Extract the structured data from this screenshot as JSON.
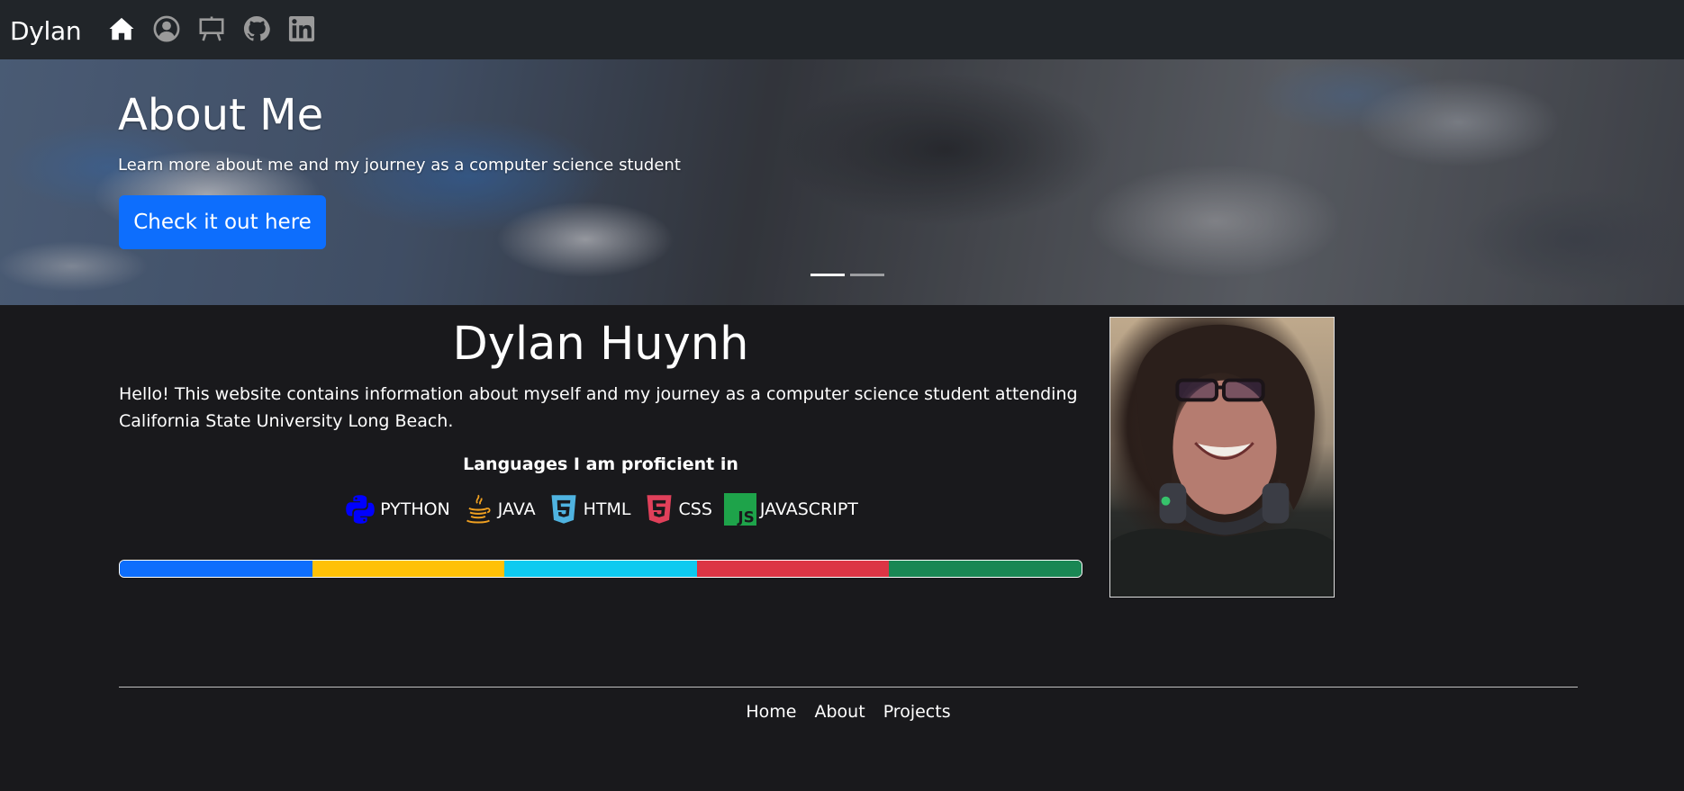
{
  "navbar": {
    "brand": "Dylan",
    "icons": [
      "home-icon",
      "person-circle-icon",
      "easel-icon",
      "github-icon",
      "linkedin-icon"
    ]
  },
  "hero": {
    "title": "About Me",
    "subtitle": "Learn more about me and my journey as a computer science student",
    "button_label": "Check it out here",
    "slides_total": 2,
    "active_slide": 1
  },
  "profile": {
    "name": "Dylan Huynh",
    "intro": "Hello! This website contains information about myself and my journey as a computer science student attending California State University Long Beach.",
    "languages_heading": "Languages I am proficient in",
    "languages": [
      {
        "name": "PYTHON",
        "icon": "python-icon",
        "color": "#0000ff"
      },
      {
        "name": "JAVA",
        "icon": "java-icon",
        "color": "#f0a020"
      },
      {
        "name": "HTML",
        "icon": "html5-icon",
        "color": "#4fb3e0"
      },
      {
        "name": "CSS",
        "icon": "css3-icon",
        "color": "#e0405a"
      },
      {
        "name": "JAVASCRIPT",
        "icon": "javascript-icon",
        "color": "#1ea34a"
      }
    ],
    "progress_colors": [
      "#0d6efd",
      "#ffc107",
      "#0dcaf0",
      "#dc3545",
      "#198754"
    ]
  },
  "footer": {
    "links": [
      "Home",
      "About",
      "Projects"
    ]
  }
}
